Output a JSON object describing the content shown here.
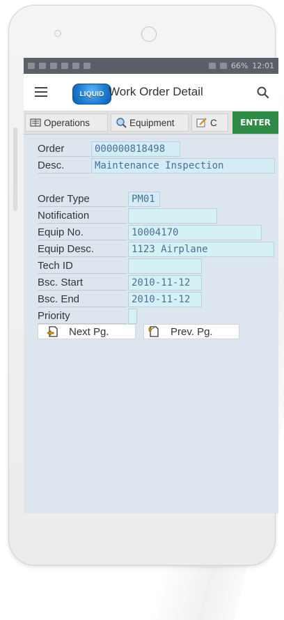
{
  "app": {
    "title": "Work Order Detail",
    "logo_text": "LIQUID"
  },
  "statusbar": {
    "time": "12:01",
    "battery": "66%"
  },
  "tabs": [
    {
      "label": "Operations",
      "icon": "operations-icon"
    },
    {
      "label": "Equipment",
      "icon": "equipment-icon"
    },
    {
      "label": "C",
      "icon": "edit-icon"
    }
  ],
  "enter_label": "ENTER",
  "form": {
    "order_label": "Order",
    "order_value": "000000818498",
    "desc_label": "Desc.",
    "desc_value": "Maintenance Inspection",
    "order_type_label": "Order Type",
    "order_type_value": "PM01",
    "notification_label": "Notification",
    "notification_value": "",
    "equip_no_label": "Equip No.",
    "equip_no_value": "10004170",
    "equip_desc_label": "Equip Desc.",
    "equip_desc_value": "1123 Airplane",
    "tech_id_label": "Tech ID",
    "tech_id_value": "",
    "bsc_start_label": "Bsc. Start",
    "bsc_start_value": "2010-11-12",
    "bsc_end_label": "Bsc. End",
    "bsc_end_value": "2010-11-12",
    "priority_label": "Priority",
    "priority_value": ""
  },
  "buttons": {
    "next_pg": "Next Pg.",
    "prev_pg": "Prev. Pg."
  },
  "colors": {
    "enter_bg": "#2e8b43",
    "field_bg": "#d3ecf5",
    "screen_bg": "#dde6ef",
    "logo": "#1f7fd6"
  }
}
